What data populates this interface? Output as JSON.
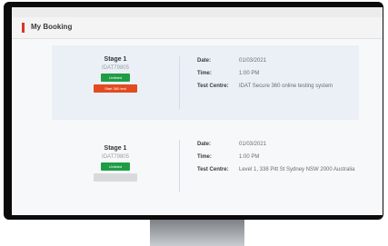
{
  "page": {
    "title": "My Booking"
  },
  "bookings": [
    {
      "stage": "Stage 1",
      "reference": "IDAT79805",
      "status_label": "Unlisted",
      "action_label": "Start 360 test",
      "date_label": "Date:",
      "date": "01/03/2021",
      "time_label": "Time:",
      "time": "1:00 PM",
      "centre_label": "Test Centre:",
      "centre": "IDAT Secure 360 online testing system"
    },
    {
      "stage": "Stage 1",
      "reference": "IDAT79805",
      "status_label": "Unlisted",
      "action_label": "Start test",
      "date_label": "Date:",
      "date": "01/03/2021",
      "time_label": "Time:",
      "time": "1:00 PM",
      "centre_label": "Test Centre:",
      "centre": "Level 1, 338 Pitt St Sydney NSW 2000 Australia"
    }
  ],
  "colors": {
    "accent": "#d9362b",
    "status_green": "#1f9d45",
    "action_orange": "#e24b22",
    "action_disabled": "#d8dadc",
    "card_highlight": "#eaf0f6"
  }
}
